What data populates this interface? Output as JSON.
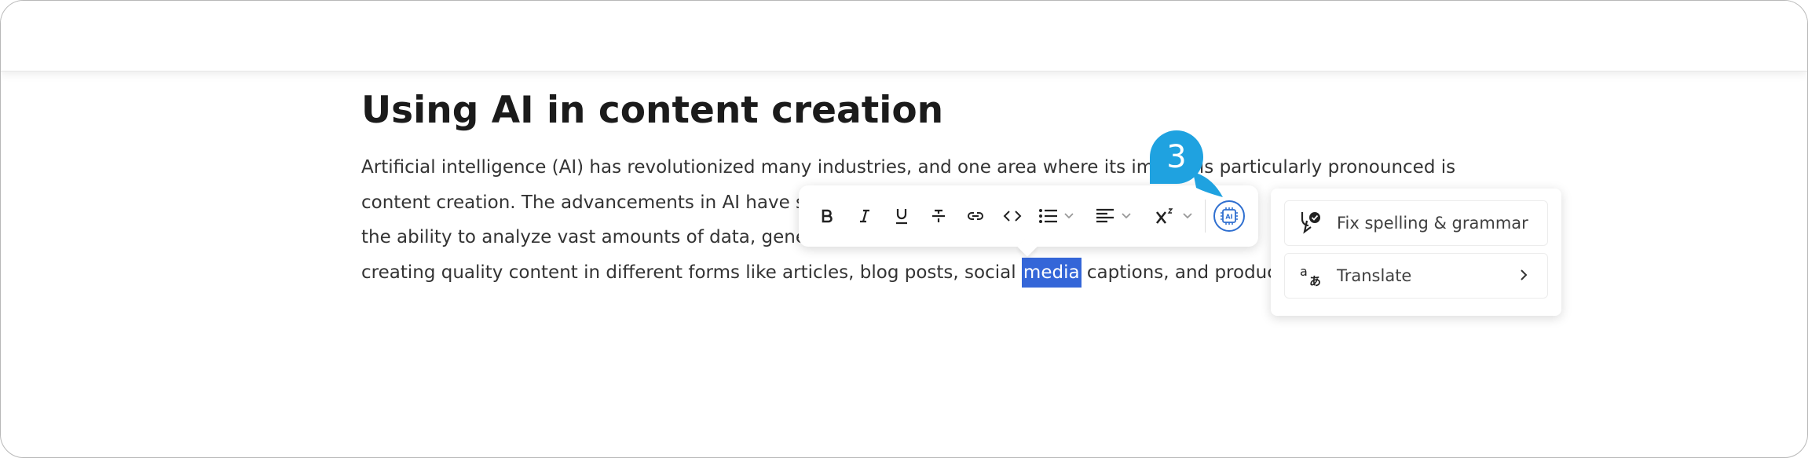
{
  "article": {
    "title": "Using AI in content creation",
    "lines": [
      "Artificial intelligence (AI) has revolutionized many industries, and one area where its impact is particularly pronounced is",
      "content creation. The advancements in AI have si",
      "the ability to analyze vast amounts of data, gener",
      "creating quality content in different forms like articles, blog posts, social "
    ],
    "selected_word": "media",
    "line4_after": " captions, and product d"
  },
  "toolbar": {
    "buttons": [
      {
        "name": "bold",
        "icon": "bold-icon"
      },
      {
        "name": "italic",
        "icon": "italic-icon"
      },
      {
        "name": "underline",
        "icon": "underline-icon"
      },
      {
        "name": "strikethrough",
        "icon": "strikethrough-icon"
      },
      {
        "name": "link",
        "icon": "link-icon"
      },
      {
        "name": "code",
        "icon": "code-icon"
      },
      {
        "name": "bulleted-list",
        "icon": "bulleted-list-icon",
        "dropdown": true
      },
      {
        "name": "alignment",
        "icon": "align-left-icon",
        "dropdown": true
      },
      {
        "name": "superscript",
        "icon": "superscript-icon",
        "dropdown": true
      },
      {
        "name": "ai-assistant",
        "icon": "ai-chip-icon",
        "active": true
      }
    ],
    "ai_label": "AI"
  },
  "ai_menu": {
    "items": [
      {
        "label": "Fix spelling & grammar",
        "icon": "spellcheck-icon"
      },
      {
        "label": "Translate",
        "icon": "translate-icon",
        "submenu": true
      }
    ]
  },
  "callout": {
    "number": "3",
    "color": "#1fa2e0"
  },
  "colors": {
    "selection": "#3466d8",
    "accent": "#2f6fd0",
    "text": "#333333"
  }
}
